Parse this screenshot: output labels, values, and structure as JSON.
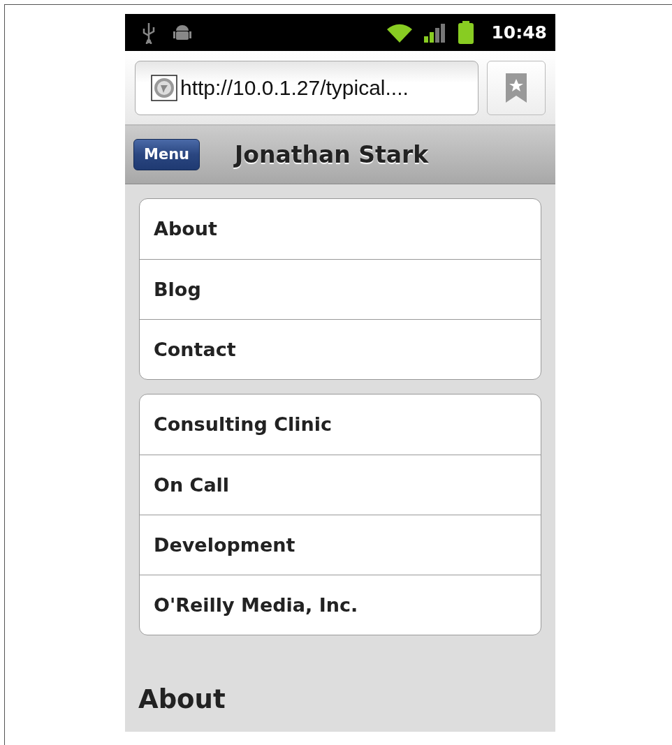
{
  "status_bar": {
    "time": "10:48"
  },
  "browser": {
    "url": "http://10.0.1.27/typical...."
  },
  "header": {
    "menu_button": "Menu",
    "title": "Jonathan Stark"
  },
  "menu_groups": [
    {
      "items": [
        "About",
        "Blog",
        "Contact"
      ]
    },
    {
      "items": [
        "Consulting Clinic",
        "On Call",
        "Development",
        "O'Reilly Media, Inc."
      ]
    }
  ],
  "section_heading": "About"
}
